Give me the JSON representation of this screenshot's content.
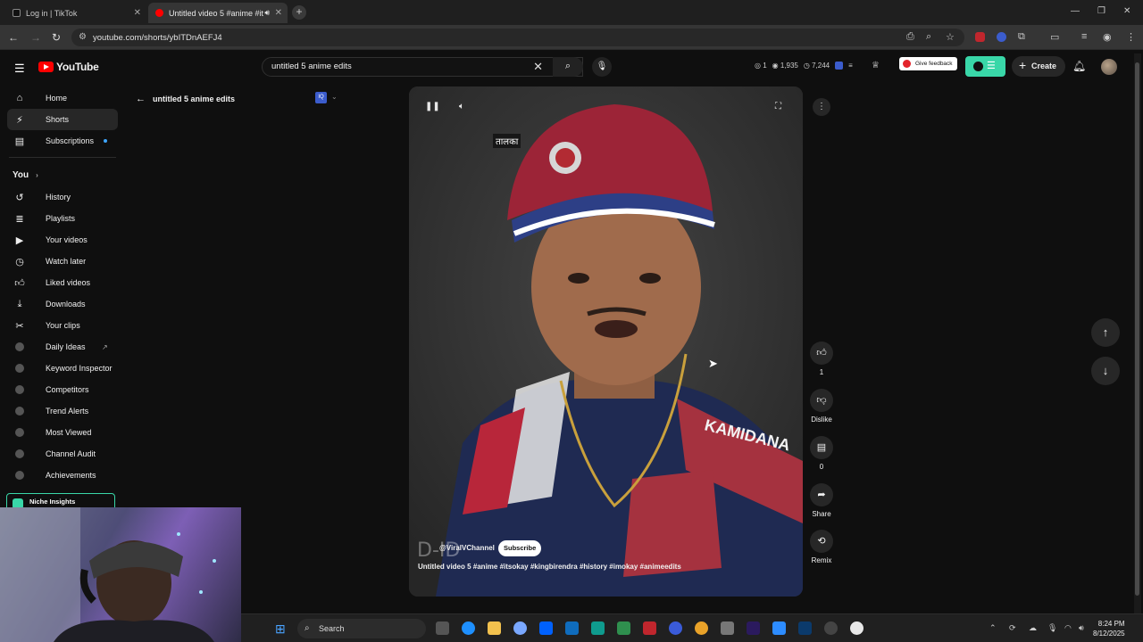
{
  "browser": {
    "tabs": [
      {
        "label": "Log in | TikTok",
        "active": false
      },
      {
        "label": "Untitled video 5 #anime #it",
        "active": true
      }
    ],
    "url": "youtube.com/shorts/ybITDnAEFJ4"
  },
  "header": {
    "logo": "YouTube",
    "search_value": "untitled 5  anime edits",
    "stats": {
      "a": "1",
      "b": "1,935",
      "c": "7,244"
    },
    "feedback": "Give feedback",
    "create": "Create"
  },
  "sidebar": {
    "main": [
      {
        "label": "Home",
        "icon": "home-icon"
      },
      {
        "label": "Shorts",
        "icon": "shorts-icon"
      },
      {
        "label": "Subscriptions",
        "icon": "subscriptions-icon"
      }
    ],
    "you_heading": "You",
    "you": [
      {
        "label": "History",
        "icon": "history-icon"
      },
      {
        "label": "Playlists",
        "icon": "playlists-icon"
      },
      {
        "label": "Your videos",
        "icon": "your-videos-icon"
      },
      {
        "label": "Watch later",
        "icon": "clock-icon"
      },
      {
        "label": "Liked videos",
        "icon": "thumbs-up-icon"
      },
      {
        "label": "Downloads",
        "icon": "download-icon"
      },
      {
        "label": "Your clips",
        "icon": "scissors-icon"
      }
    ],
    "vidiq": [
      {
        "label": "Daily Ideas"
      },
      {
        "label": "Keyword Inspector"
      },
      {
        "label": "Competitors"
      },
      {
        "label": "Trend Alerts"
      },
      {
        "label": "Most Viewed"
      },
      {
        "label": "Channel Audit"
      },
      {
        "label": "Achievements"
      }
    ],
    "niche": "Niche Insights"
  },
  "back": {
    "label": "untitled 5 anime edits"
  },
  "video": {
    "caption": "तालका",
    "channel": "@ViralVChannel",
    "subscribe": "Subscribe",
    "title": "Untitled video 5 #anime #itsokay #kingbirendra #history #imokay #animeedits",
    "watermark": "D-ID"
  },
  "actions": {
    "like_count": "1",
    "dislike": "Dislike",
    "comments": "0",
    "share": "Share",
    "remix": "Remix"
  },
  "taskbar": {
    "search": "Search",
    "time": "8:24 PM",
    "date": "8/12/2025"
  },
  "colors": {
    "accent": "#3ea6ff",
    "yt_red": "#ff0000",
    "vidiq": "#39d7a8"
  }
}
